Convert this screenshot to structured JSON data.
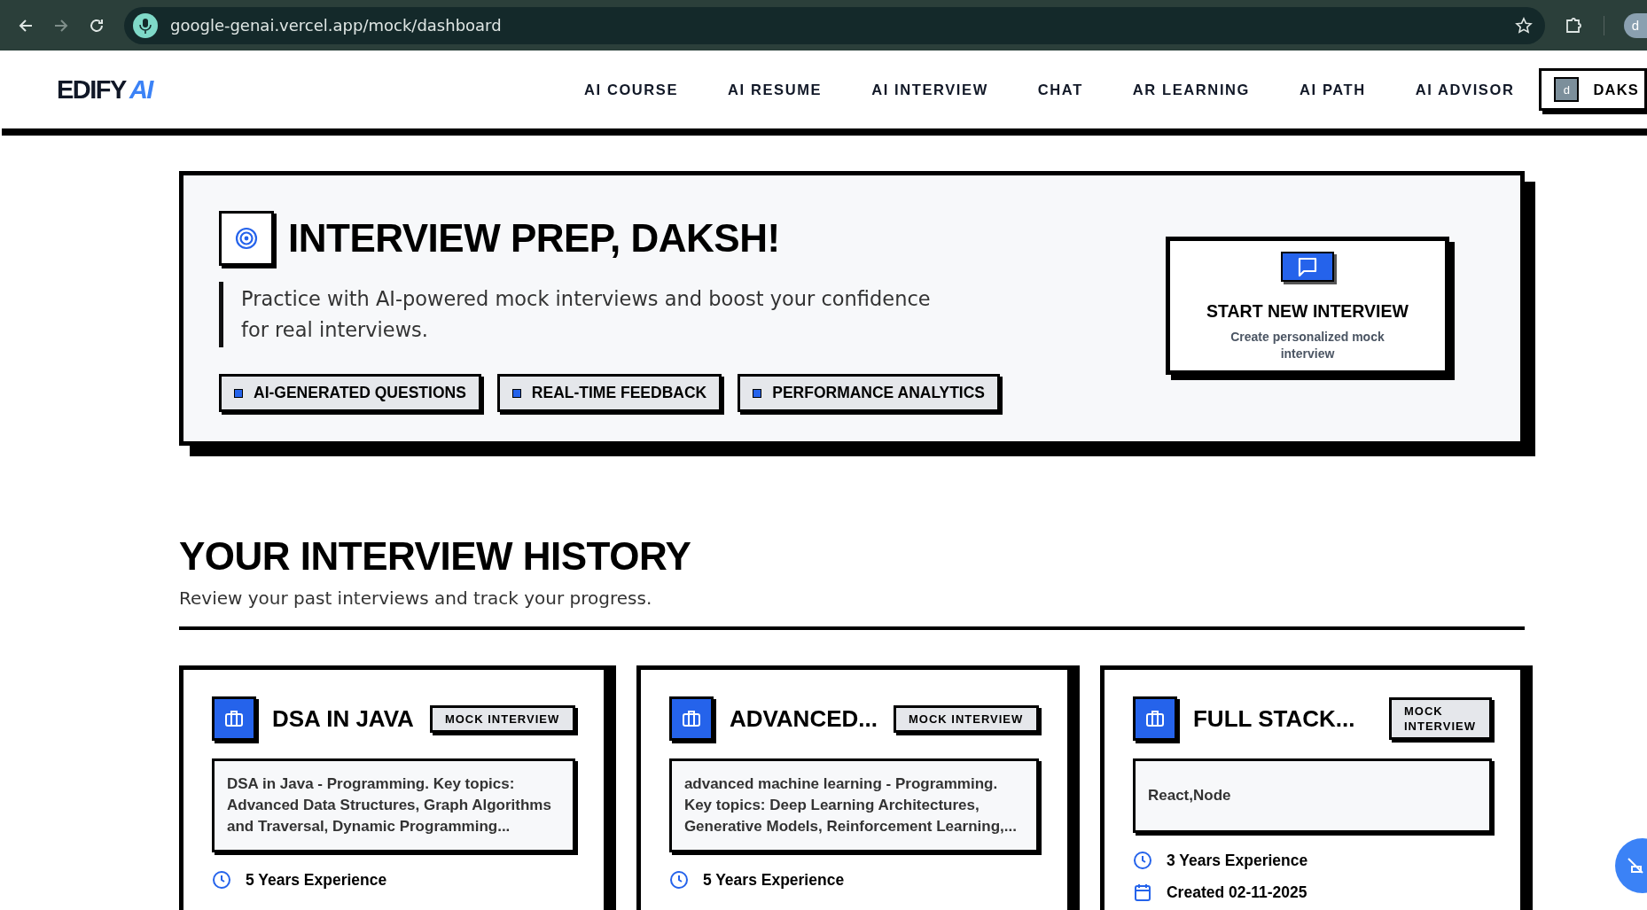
{
  "browser": {
    "url": "google-genai.vercel.app/mock/dashboard",
    "profile": "d"
  },
  "nav": {
    "logo": {
      "text": "EDIFY",
      "accent": "AI"
    },
    "items": [
      "AI COURSE",
      "AI RESUME",
      "AI INTERVIEW",
      "CHAT",
      "AR LEARNING",
      "AI PATH",
      "AI ADVISOR"
    ],
    "user": {
      "avatar": "d",
      "name": "DAKS"
    }
  },
  "hero": {
    "title": "INTERVIEW PREP, DAKSH!",
    "subtitle": "Practice with AI-powered mock interviews and boost your confidence for real interviews.",
    "features": [
      "AI-GENERATED QUESTIONS",
      "REAL-TIME FEEDBACK",
      "PERFORMANCE ANALYTICS"
    ],
    "start_card": {
      "title": "START NEW INTERVIEW",
      "subtitle": "Create personalized mock interview"
    }
  },
  "history": {
    "title": "YOUR INTERVIEW HISTORY",
    "subtitle": "Review your past interviews and track your progress.",
    "cards": [
      {
        "title": "DSA IN JAVA",
        "badge": "MOCK INTERVIEW",
        "description": "DSA in Java - Programming. Key topics: Advanced Data Structures, Graph Algorithms and Traversal, Dynamic Programming...",
        "details": [
          {
            "kind": "experience",
            "text": "5 Years Experience"
          }
        ]
      },
      {
        "title": "ADVANCED...",
        "badge": "MOCK INTERVIEW",
        "description": "advanced machine learning - Programming. Key topics: Deep Learning Architectures, Generative Models, Reinforcement Learning,...",
        "details": [
          {
            "kind": "experience",
            "text": "5 Years Experience"
          }
        ]
      },
      {
        "title": "FULL STACK...",
        "badge": "MOCK INTERVIEW",
        "description": "React,Node",
        "details": [
          {
            "kind": "experience",
            "text": "3 Years Experience"
          },
          {
            "kind": "created",
            "text": "Created 02-11-2025"
          }
        ]
      }
    ]
  }
}
